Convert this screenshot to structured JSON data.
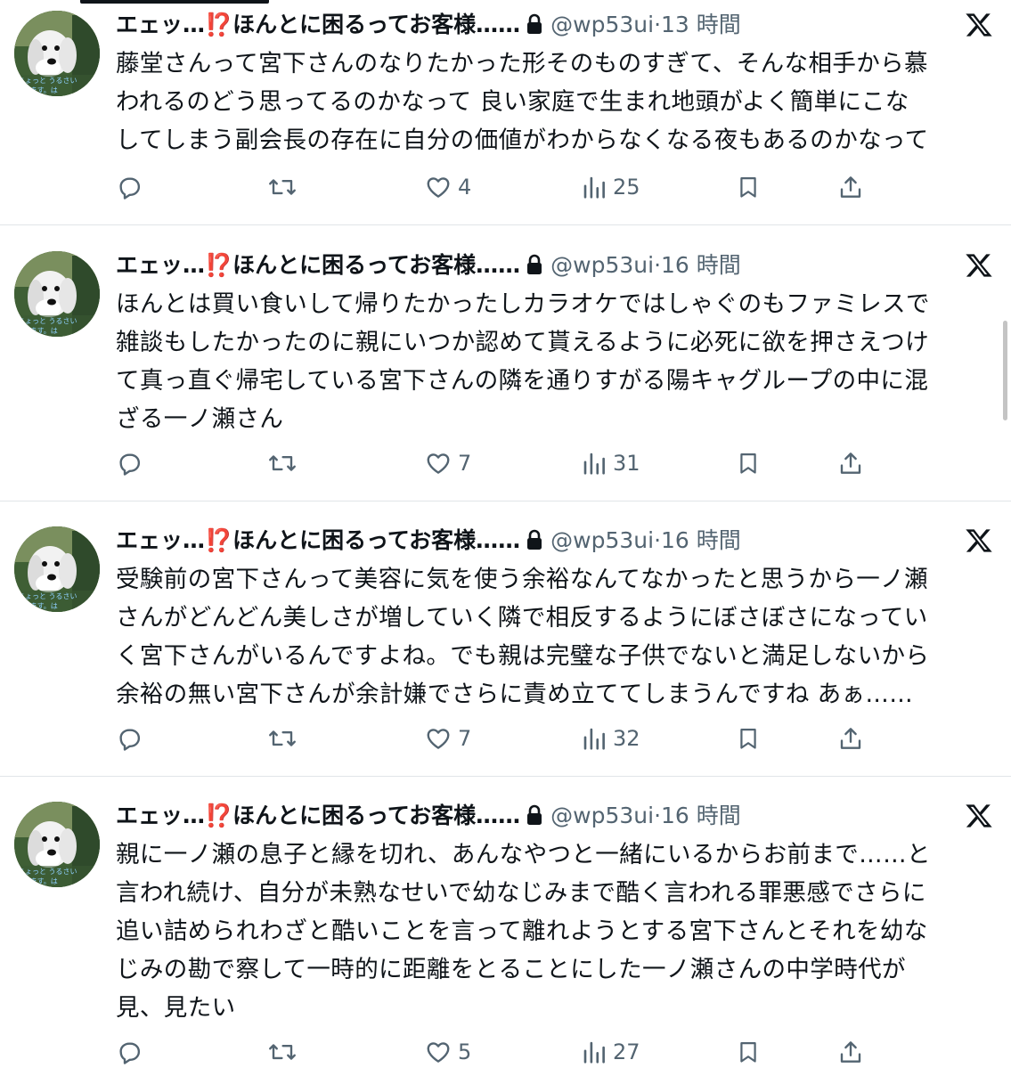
{
  "tweets": [
    {
      "name": "エェッ…⁉️ほんとに困るってお客様……",
      "handle": "@wp53ui",
      "dot": "·",
      "time": "13 時間",
      "lines": [
        "藤堂さんって宮下さんのなりたかった形そのものすぎて、そんな相手から慕",
        "われるのどう思ってるのかなって 良い家庭で生まれ地頭がよく簡単にこな",
        "してしまう副会長の存在に自分の価値がわからなくなる夜もあるのかなって"
      ],
      "likes": "4",
      "views": "25"
    },
    {
      "name": "エェッ…⁉️ほんとに困るってお客様……",
      "handle": "@wp53ui",
      "dot": "·",
      "time": "16 時間",
      "lines": [
        "ほんとは買い食いして帰りたかったしカラオケではしゃぐのもファミレスで",
        "雑談もしたかったのに親にいつか認めて貰えるように必死に欲を押さえつけ",
        "て真っ直ぐ帰宅している宮下さんの隣を通りすがる陽キャグループの中に混",
        "ざる一ノ瀬さん"
      ],
      "likes": "7",
      "views": "31"
    },
    {
      "name": "エェッ…⁉️ほんとに困るってお客様……",
      "handle": "@wp53ui",
      "dot": "·",
      "time": "16 時間",
      "lines": [
        "受験前の宮下さんって美容に気を使う余裕なんてなかったと思うから一ノ瀬",
        "さんがどんどん美しさが増していく隣で相反するようにぼさぼさになってい",
        "く宮下さんがいるんですよね。でも親は完璧な子供でないと満足しないから",
        "余裕の無い宮下さんが余計嫌でさらに責め立ててしまうんですね あぁ……"
      ],
      "likes": "7",
      "views": "32"
    },
    {
      "name": "エェッ…⁉️ほんとに困るってお客様……",
      "handle": "@wp53ui",
      "dot": "·",
      "time": "16 時間",
      "lines": [
        "親に一ノ瀬の息子と縁を切れ、あんなやつと一緒にいるからお前まで……と",
        "言われ続け、自分が未熟なせいで幼なじみまで酷く言われる罪悪感でさらに",
        "追い詰められわざと酷いことを言って離れようとする宮下さんとそれを幼な",
        "じみの勘で察して一時的に距離をとることにした一ノ瀬さんの中学時代が",
        "見、見たい"
      ],
      "likes": "5",
      "views": "27"
    }
  ],
  "avatar_caption": [
    "ちょっと うるさい",
    "てます。は"
  ],
  "icons": {
    "reply": "reply-icon",
    "retweet": "retweet-icon",
    "like": "like-icon",
    "views": "views-icon",
    "bookmark": "bookmark-icon",
    "share": "share-icon",
    "lock": "lock-icon",
    "platform": "x-logo-icon"
  },
  "colors": {
    "text": "#0f1419",
    "secondary": "#536471",
    "divider": "#e1e5e8"
  }
}
